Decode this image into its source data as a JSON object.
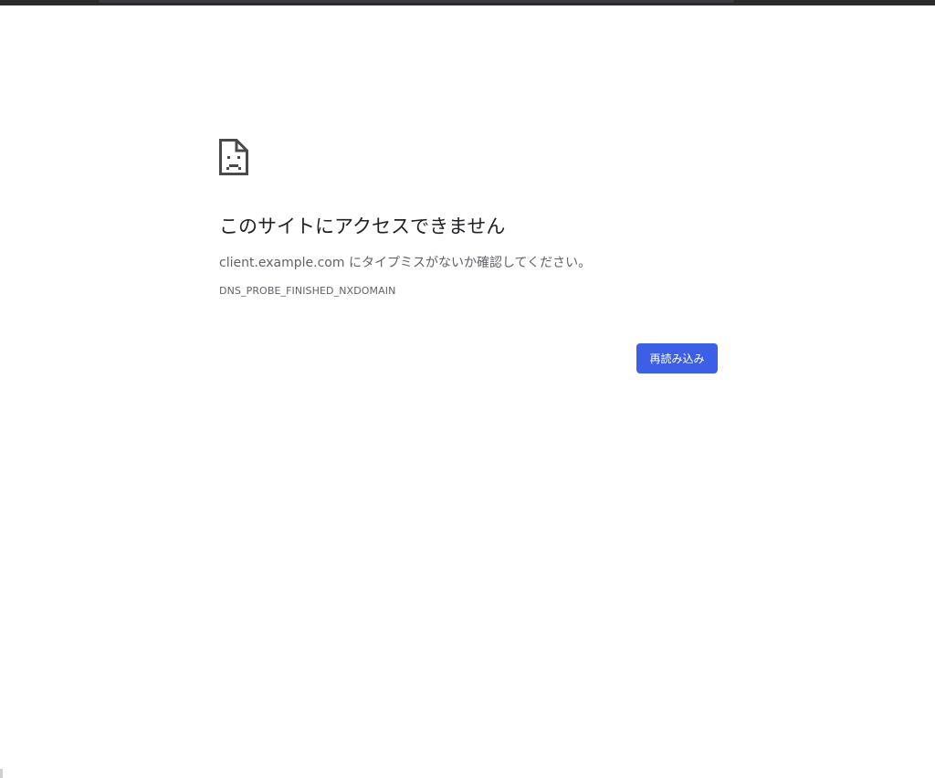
{
  "page": {
    "icon": "sad-document-icon",
    "title": "このサイトにアクセスできません",
    "message": "client.example.com にタイプミスがないか確認してください。",
    "error_code": "DNS_PROBE_FINISHED_NXDOMAIN",
    "reload_label": "再読み込み"
  },
  "colors": {
    "accent": "#3b5fe6",
    "title_text": "#202124",
    "body_text": "#5f6368"
  }
}
